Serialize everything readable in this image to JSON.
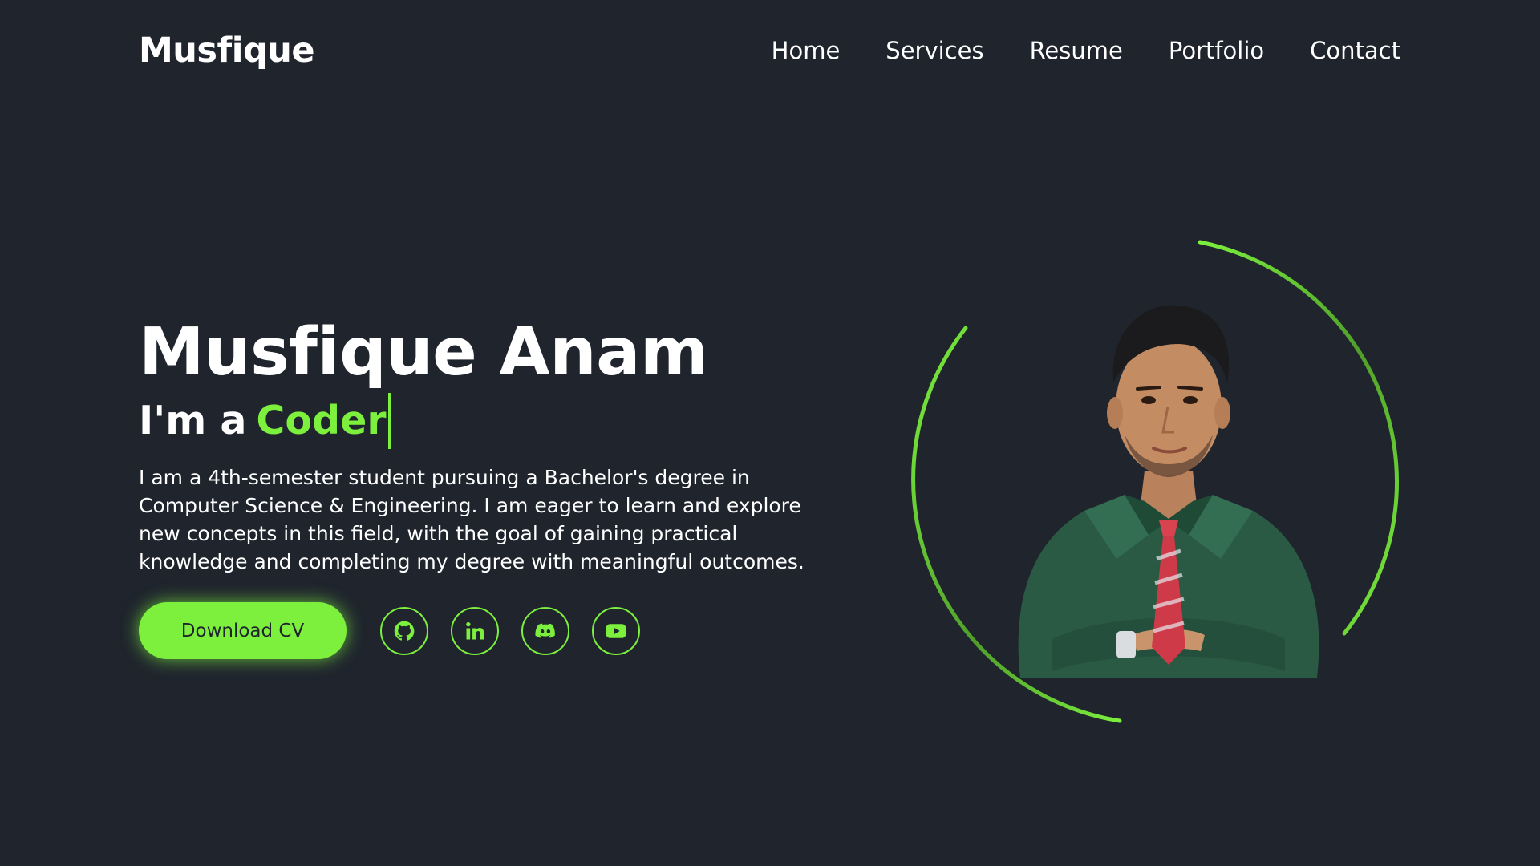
{
  "header": {
    "logo": "Musfique",
    "nav": [
      "Home",
      "Services",
      "Resume",
      "Portfolio",
      "Contact"
    ]
  },
  "hero": {
    "name": "Musfique Anam",
    "role_prefix": "I'm a",
    "role_word": "Coder",
    "description": "I am a 4th-semester student pursuing a Bachelor's degree in Computer Science & Engineering. I am eager to learn and explore new concepts in this field, with the goal of gaining practical knowledge and completing my degree with meaningful outcomes.",
    "cta_label": "Download CV"
  },
  "socials": [
    {
      "icon": "github-icon"
    },
    {
      "icon": "linkedin-icon"
    },
    {
      "icon": "discord-icon"
    },
    {
      "icon": "youtube-icon"
    }
  ],
  "colors": {
    "background": "#1f242d",
    "accent": "#7cf03d",
    "text": "#ffffff"
  }
}
